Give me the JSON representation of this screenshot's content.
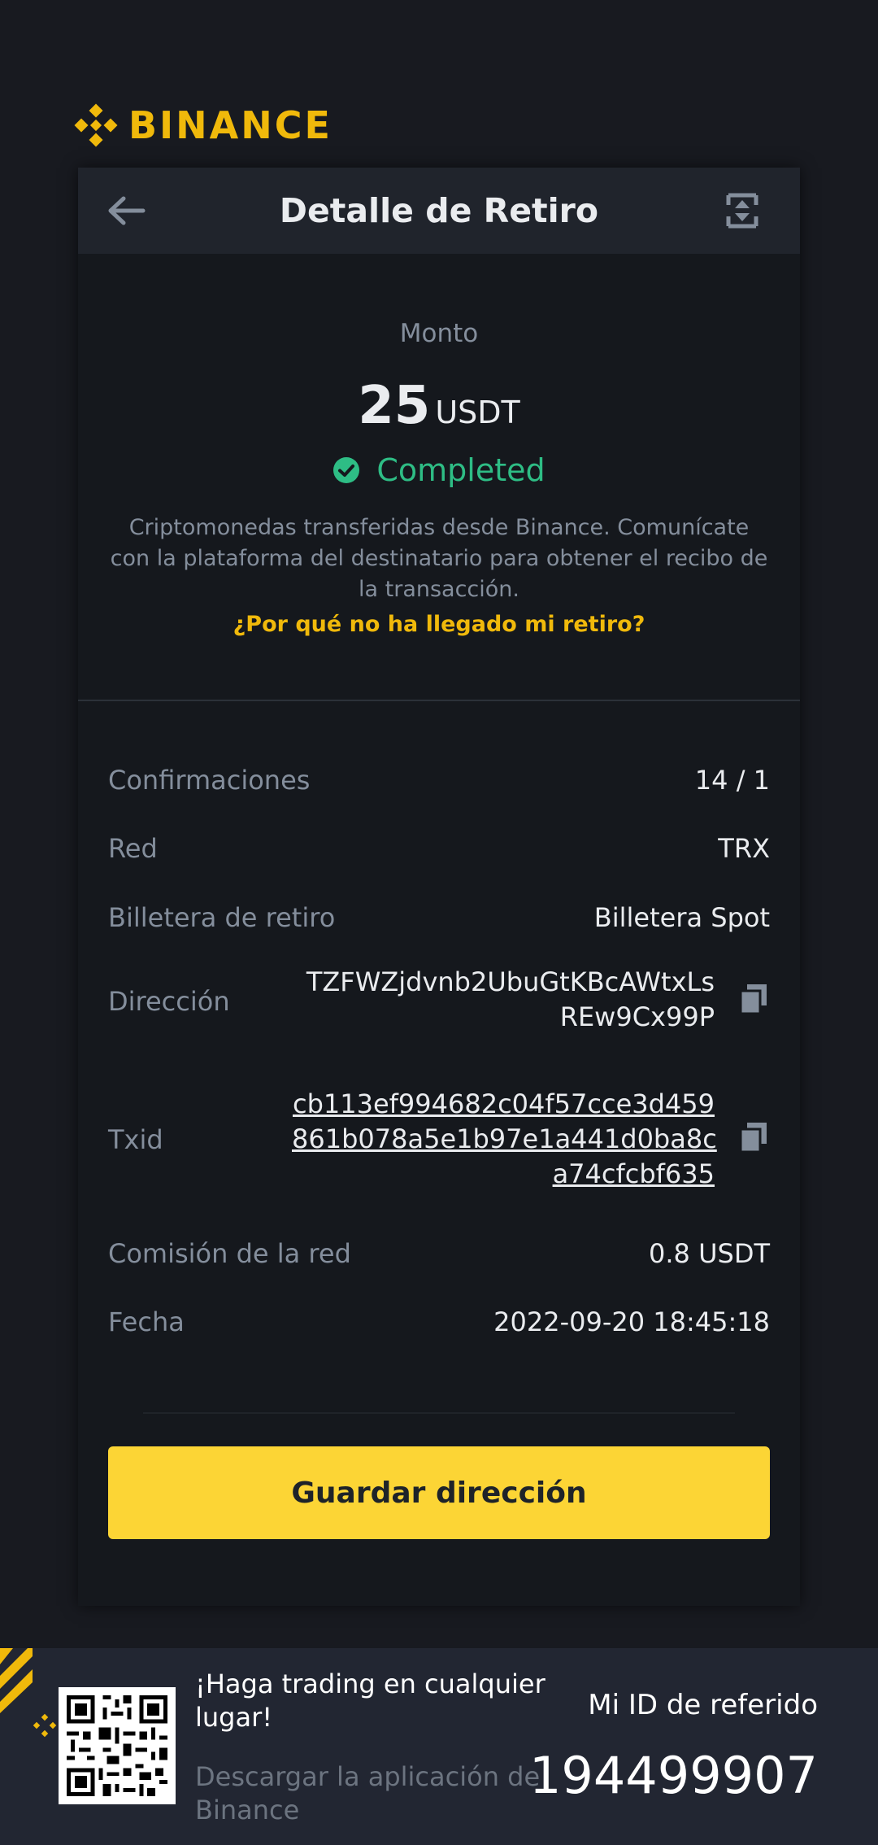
{
  "brand": {
    "name": "BINANCE",
    "color": "#F0B90B"
  },
  "header": {
    "title": "Detalle de Retiro",
    "back_icon": "arrow-left-icon",
    "share_icon": "share-icon"
  },
  "amount": {
    "label": "Monto",
    "value": "25",
    "currency": "USDT",
    "status": "Completed",
    "status_color": "#2EBD85",
    "note": "Criptomonedas transferidas desde Binance. Comunícate con la plataforma del destinatario para obtener el recibo de la transacción.",
    "help_link": "¿Por qué no ha llegado mi retiro?"
  },
  "details": {
    "confirmations": {
      "label": "Confirmaciones",
      "value": "14 / 1"
    },
    "network": {
      "label": "Red",
      "value": "TRX"
    },
    "wallet": {
      "label": "Billetera de retiro",
      "value": "Billetera Spot"
    },
    "address": {
      "label": "Dirección",
      "line1": "TZFWZjdvnb2UbuGtKBcAWtxLs",
      "line2": "REw9Cx99P"
    },
    "txid": {
      "label": "Txid",
      "line1": "cb113ef994682c04f57cce3d459",
      "line2": "861b078a5e1b97e1a441d0ba8c",
      "line3": "a74cfcbf635"
    },
    "fee": {
      "label": "Comisión de la red",
      "value": "0.8 USDT"
    },
    "date": {
      "label": "Fecha",
      "value": "2022-09-20 18:45:18"
    }
  },
  "actions": {
    "save_address": "Guardar dirección"
  },
  "footer": {
    "promo_title": "¡Haga trading en cualquier lugar!",
    "promo_sub": "Descargar la aplicación de Binance",
    "referral_label": "Mi ID de referido",
    "referral_id": "194499907"
  }
}
